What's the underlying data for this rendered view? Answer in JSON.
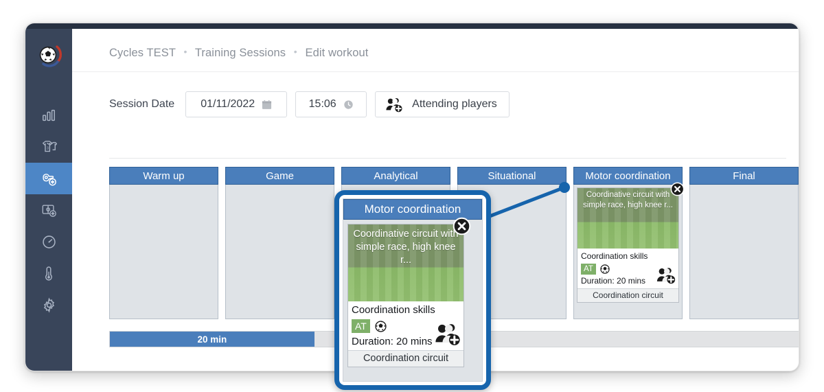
{
  "app": {
    "logo_icon": "soccer-ball-logo"
  },
  "sidebar": {
    "items": [
      {
        "icon": "bar-chart-icon",
        "active": false
      },
      {
        "icon": "jersey-squad-icon",
        "active": false
      },
      {
        "icon": "whistle-plus-icon",
        "active": true
      },
      {
        "icon": "pitch-plus-icon",
        "active": false
      },
      {
        "icon": "gauge-icon",
        "active": false
      },
      {
        "icon": "thermometer-icon",
        "active": false
      },
      {
        "icon": "gear-icon",
        "active": false
      }
    ]
  },
  "breadcrumb": {
    "items": [
      "Cycles TEST",
      "Training Sessions",
      "Edit workout"
    ],
    "separator": "•"
  },
  "session": {
    "label": "Session Date",
    "date_value": "01/11/2022",
    "date_icon": "calendar-icon",
    "time_value": "15:06",
    "time_icon": "clock-icon",
    "attending_label": "Attending players",
    "attending_icon": "players-add-icon"
  },
  "board": {
    "columns": [
      {
        "title": "Warm up",
        "cards": []
      },
      {
        "title": "Game",
        "cards": []
      },
      {
        "title": "Analytical",
        "cards": []
      },
      {
        "title": "Situational",
        "cards": []
      },
      {
        "title": "Motor coordination",
        "cards": [
          {
            "image_caption": "Coordinative circuit with simple race, high knee r...",
            "title": "Coordination skills",
            "tag": "AT",
            "tag_color": "#7fb069",
            "ball_icon": "soccer-ball-icon",
            "people_icon": "players-add-icon",
            "close_icon": "close-icon",
            "duration": "Duration: 20 mins",
            "footer": "Coordination circuit"
          }
        ]
      },
      {
        "title": "Final",
        "cards": []
      }
    ]
  },
  "duration_bar": {
    "label": "20 min",
    "fill_percent": 29.3,
    "fill_color": "#4a7ebb",
    "track_color": "#e2e3e5"
  },
  "zoom_popup": {
    "header": "Motor coordination",
    "card": {
      "image_caption": "Coordinative circuit with simple race, high knee r...",
      "title": "Coordination skills",
      "tag": "AT",
      "ball_icon": "soccer-ball-icon",
      "people_icon": "players-add-icon",
      "close_icon": "close-icon",
      "duration": "Duration: 20 mins",
      "footer": "Coordination circuit"
    },
    "border_color": "#1664ac"
  },
  "colors": {
    "sidebar_bg": "#39455a",
    "topbar_bg": "#273142",
    "accent_blue": "#4a7ebb",
    "active_item": "#4d86c6",
    "board_cell": "#dfe3e7"
  }
}
